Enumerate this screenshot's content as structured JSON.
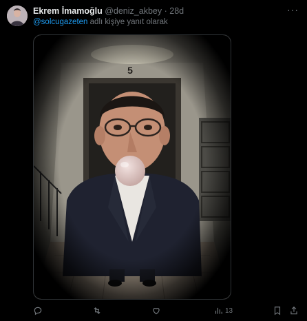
{
  "tweet": {
    "author_name": "Ekrem İmamoğlu",
    "handle": "@deniz_akbey",
    "separator": "·",
    "time": "28d",
    "more_label": "···",
    "reply_mention": "@solcugazeten",
    "reply_suffix": " adlı kişiye yanıt olarak",
    "door_number": "5"
  },
  "actions": {
    "reply_icon": "reply-icon",
    "retweet_icon": "retweet-icon",
    "like_icon": "heart-icon",
    "views_icon": "views-chart-icon",
    "views_count": "13",
    "bookmark_icon": "bookmark-icon",
    "share_icon": "share-icon"
  },
  "colors": {
    "background": "#000000",
    "text": "#e7e9ea",
    "muted": "#71767b",
    "link": "#1d9bf0"
  }
}
